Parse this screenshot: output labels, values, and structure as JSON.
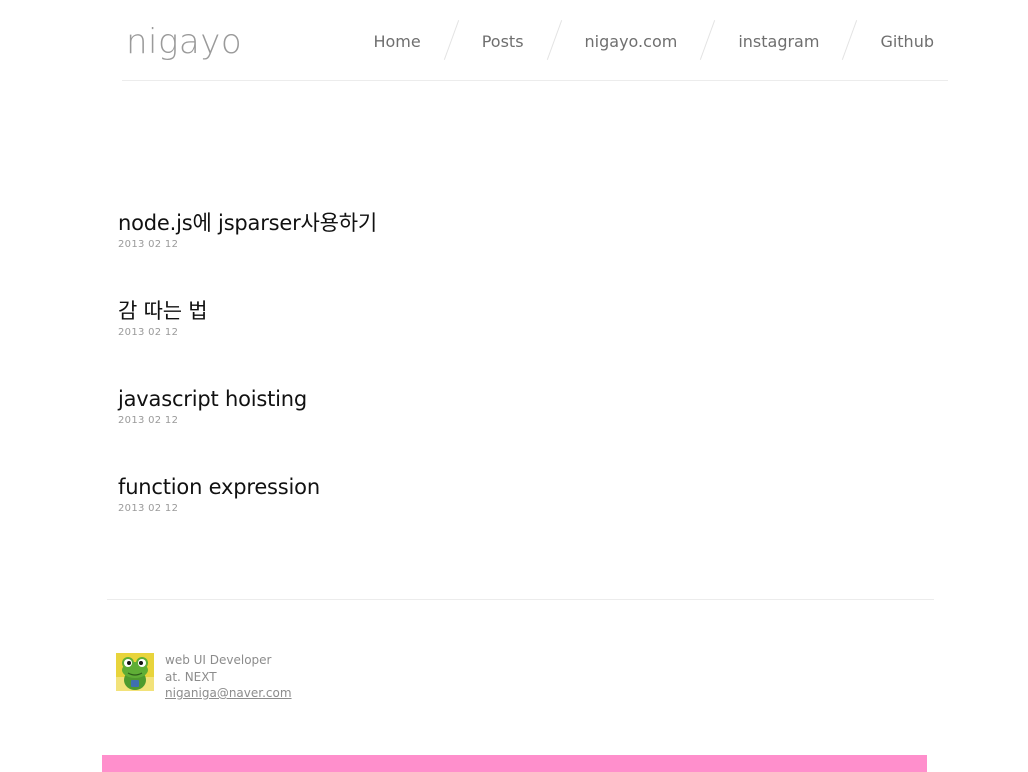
{
  "site": {
    "title": "nigayo"
  },
  "nav": {
    "items": [
      {
        "label": "Home"
      },
      {
        "label": "Posts"
      },
      {
        "label": "nigayo.com"
      },
      {
        "label": "instagram"
      },
      {
        "label": "Github"
      }
    ]
  },
  "posts": [
    {
      "title": "node.js에 jsparser사용하기",
      "date": "2013 02 12"
    },
    {
      "title": "감 따는 법",
      "date": "2013 02 12"
    },
    {
      "title": "javascript hoisting",
      "date": "2013 02 12"
    },
    {
      "title": "function expression",
      "date": "2013 02 12"
    }
  ],
  "author": {
    "role": "web UI Developer",
    "company": "at. NEXT",
    "email": "niganiga@naver.com"
  },
  "colors": {
    "accent_bar": "#ff8fcc",
    "logo": "#9a9a9a",
    "nav_text": "#6f6f6f"
  },
  "icons": {
    "avatar": "frog-avatar-icon"
  }
}
